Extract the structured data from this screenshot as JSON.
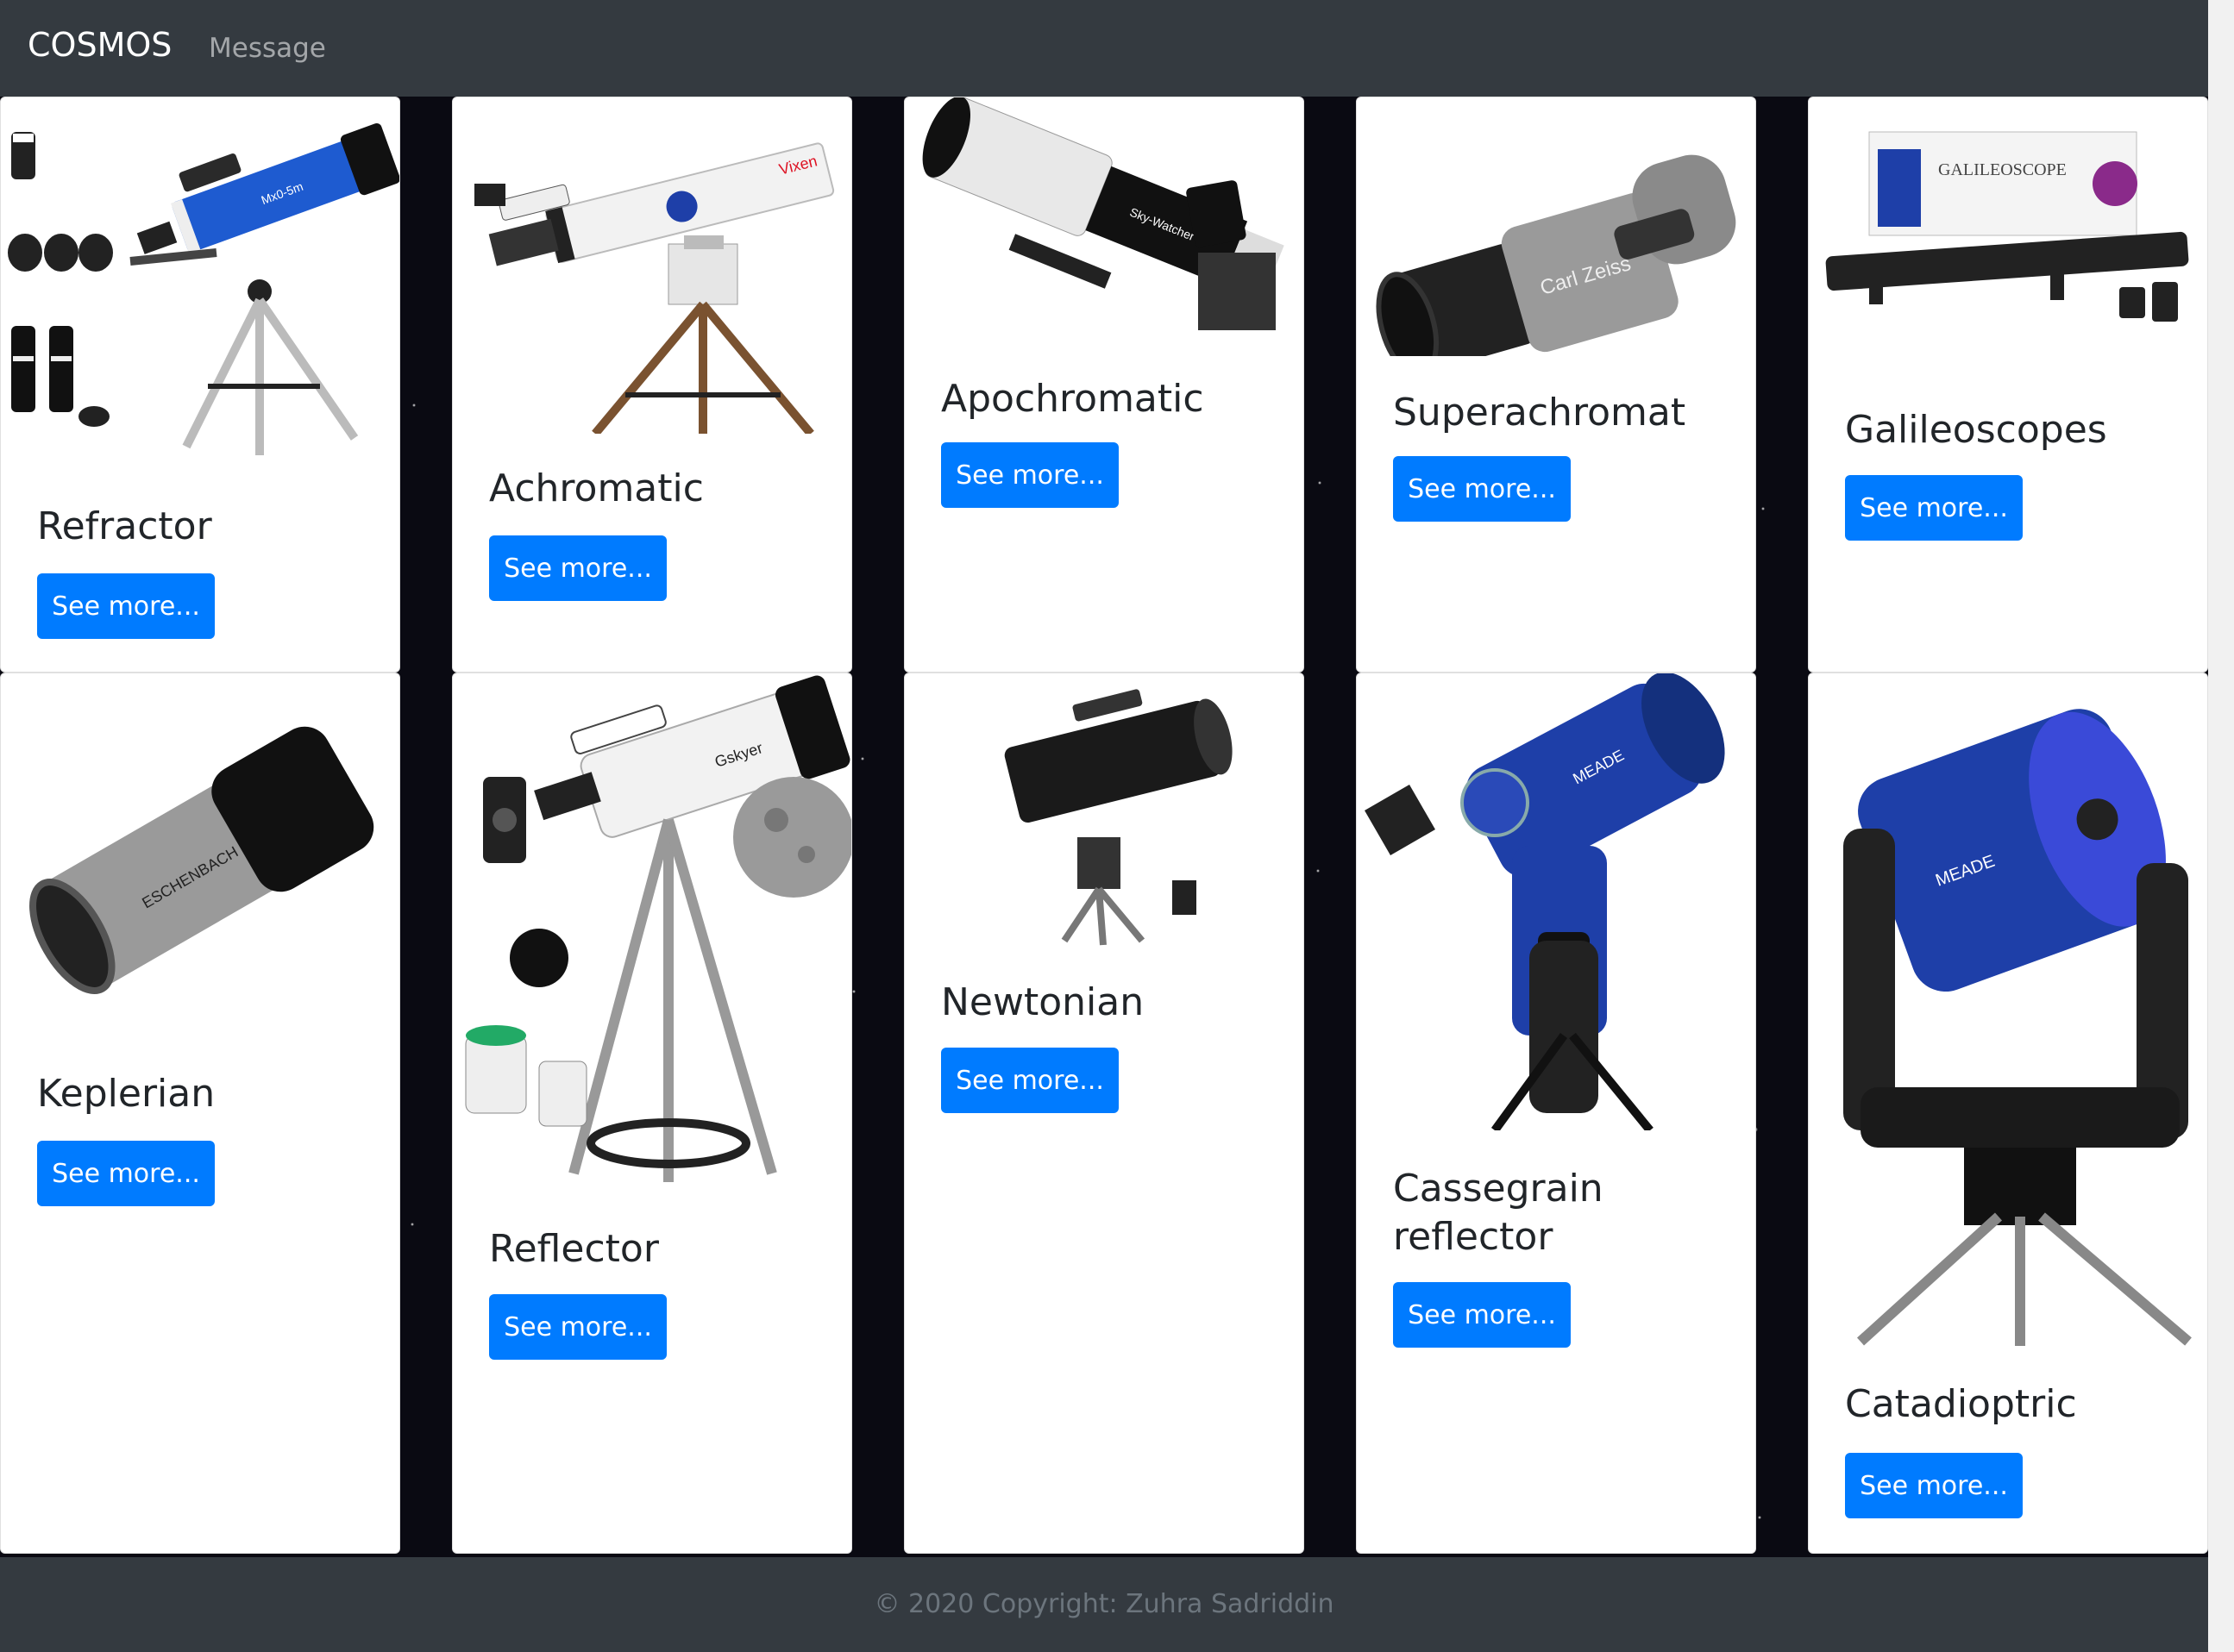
{
  "navbar": {
    "brand": "COSMOS",
    "links": [
      "Message"
    ]
  },
  "cards": [
    {
      "title": "Refractor",
      "button": "See more..."
    },
    {
      "title": "Achromatic",
      "button": "See more..."
    },
    {
      "title": "Apochromatic",
      "button": "See more..."
    },
    {
      "title": "Superachromat",
      "button": "See more..."
    },
    {
      "title": "Galileoscopes",
      "button": "See more..."
    },
    {
      "title": "Keplerian",
      "button": "See more..."
    },
    {
      "title": "Reflector",
      "button": "See more..."
    },
    {
      "title": "Newtonian",
      "button": "See more..."
    },
    {
      "title": "Cassegrain reflector",
      "button": "See more..."
    },
    {
      "title": "Catadioptric",
      "button": "See more..."
    }
  ],
  "image_labels": {
    "refractor_brand": "Mx0-5m",
    "achromatic_brand": "Vixen",
    "apochromatic_brand": "Sky-Watcher",
    "superachromat_brand": "Carl Zeiss",
    "galileoscope_brand": "GALILEOSCOPE",
    "keplerian_brand": "ESCHENBACH",
    "reflector_brand": "Gskyer",
    "cassegrain_brand": "MEADE",
    "catadioptric_brand": "MEADE"
  },
  "footer": {
    "copyright": "© 2020 Copyright: Zuhra Sadriddin"
  },
  "colors": {
    "navbar": "#343a40",
    "primary": "#007bff",
    "card": "#ffffff"
  }
}
